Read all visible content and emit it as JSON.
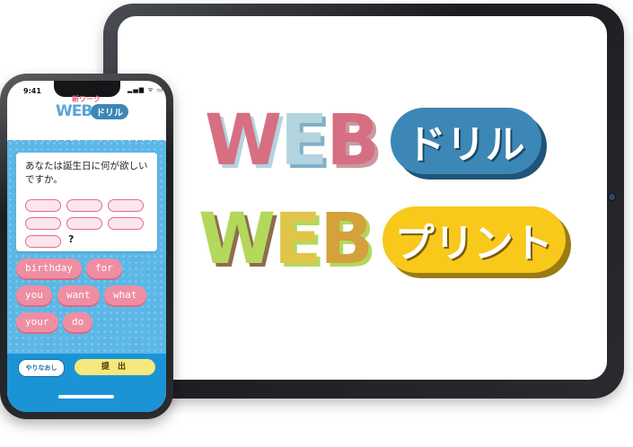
{
  "tablet": {
    "logo1": {
      "letters": [
        "W",
        "E",
        "B"
      ],
      "letter_colors": [
        "#d66f82",
        "#b3d3df",
        "#d66f82"
      ],
      "pill_text": "ドリル",
      "pill_color": "#3c87b5"
    },
    "logo2": {
      "letters": [
        "W",
        "E",
        "B"
      ],
      "letter_colors": [
        "#b3d85b",
        "#e0c54a",
        "#d4a13a"
      ],
      "pill_text": "プリント",
      "pill_color": "#f8c81b"
    }
  },
  "phone": {
    "status": {
      "time": "9:41",
      "icons": "▂▄▆ ᯤ ▭"
    },
    "header": {
      "title_top": "新ワーク",
      "title_web": "WEB",
      "title_badge": "ドリル"
    },
    "question": {
      "text": "あなたは誕生日に何が欲しいですか。",
      "blanks": 7,
      "suffix": "?"
    },
    "choices": [
      "birthday",
      "for",
      "you",
      "want",
      "what",
      "your",
      "do"
    ],
    "buttons": {
      "redo": "やりなおし",
      "submit": "提 出"
    }
  }
}
